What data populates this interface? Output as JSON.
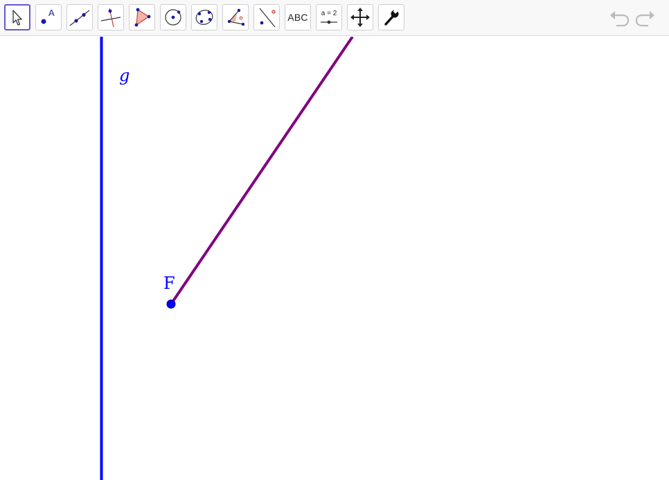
{
  "toolbar": {
    "tools": [
      {
        "id": "move",
        "icon": "move-arrow-icon",
        "active": true
      },
      {
        "id": "point",
        "icon": "point-icon"
      },
      {
        "id": "line",
        "icon": "line-through-two-points-icon"
      },
      {
        "id": "perpendicular",
        "icon": "perpendicular-line-icon"
      },
      {
        "id": "polygon",
        "icon": "polygon-icon"
      },
      {
        "id": "circle",
        "icon": "circle-center-point-icon"
      },
      {
        "id": "conic",
        "icon": "conic-through-five-points-icon"
      },
      {
        "id": "angle",
        "icon": "angle-icon"
      },
      {
        "id": "reflect",
        "icon": "reflect-about-line-icon"
      },
      {
        "id": "text",
        "icon": "text-icon",
        "label": "ABC"
      },
      {
        "id": "slider",
        "icon": "slider-icon",
        "label": "a = 2"
      },
      {
        "id": "move-graphics",
        "icon": "move-graphics-view-icon"
      },
      {
        "id": "settings",
        "icon": "wrench-icon"
      }
    ],
    "undo_icon": "undo-icon",
    "redo_icon": "redo-icon"
  },
  "colors": {
    "toolbar_bg": "#f8f8f8",
    "active_tool_border": "#6557d2",
    "line_g": "#0000ff",
    "point_F": "#0000ff",
    "segment": "#800080",
    "history_disabled": "#bbbbbb"
  },
  "graphics": {
    "line_g": {
      "label": "g"
    },
    "point_F": {
      "label": "F"
    }
  }
}
